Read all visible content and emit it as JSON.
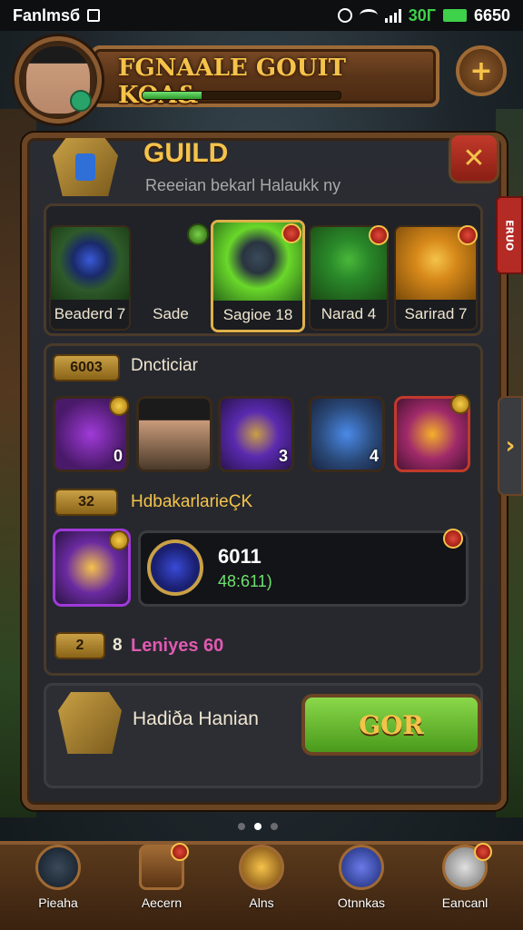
{
  "status_bar": {
    "left_text": "Fanlmsб",
    "battery_text": "30Г",
    "right_text": "6650"
  },
  "header": {
    "title": "FGNAALE GOUIT KOA&",
    "progress_fraction": 0.3,
    "add_glyph": "+"
  },
  "guild": {
    "title": "GUILD",
    "subtitle": "Reeeian bekarl Halaukk ny",
    "close_glyph": "✕",
    "side_tab_text": "ERUO"
  },
  "top_items": [
    {
      "label": "Beaderd 7",
      "color": "#2e5a2a",
      "gem": "#3a5ad8"
    },
    {
      "label": "Sade",
      "color": "none",
      "gem": "none"
    },
    {
      "label": "Sagioe 18",
      "color": "#6ad82a",
      "gem": "#3a4a5a"
    },
    {
      "label": "Narad 4",
      "color": "#2a6a2a",
      "gem": "#2a8a2a"
    },
    {
      "label": "Sarirad 7",
      "color": "#d88a1a",
      "gem": "#f5b02a"
    }
  ],
  "middle": {
    "tag1": "6003",
    "label1": "Dncticiar",
    "gems": [
      {
        "count": "0",
        "color": "#6a2aa0"
      },
      {
        "count": "",
        "color": "#4a3a2a"
      },
      {
        "count": "3",
        "color": "#5a2ab0"
      },
      {
        "count": "4",
        "color": "#2a4a7a"
      },
      {
        "count": "",
        "color": "#a02a6a"
      }
    ],
    "tag2": "32",
    "label2": "HdbakarlarieÇK",
    "reward_value": "6011",
    "reward_sub": "48:611)",
    "tag3": "2",
    "label3_number": "8",
    "label3": "Leniyes 60"
  },
  "bottom": {
    "name": "Hadiða Hanian",
    "go_label": "GOR"
  },
  "nav": [
    {
      "label": "Pieaha"
    },
    {
      "label": "Aecern"
    },
    {
      "label": "Alns"
    },
    {
      "label": "Otnnkas"
    },
    {
      "label": "Eancanl"
    }
  ]
}
